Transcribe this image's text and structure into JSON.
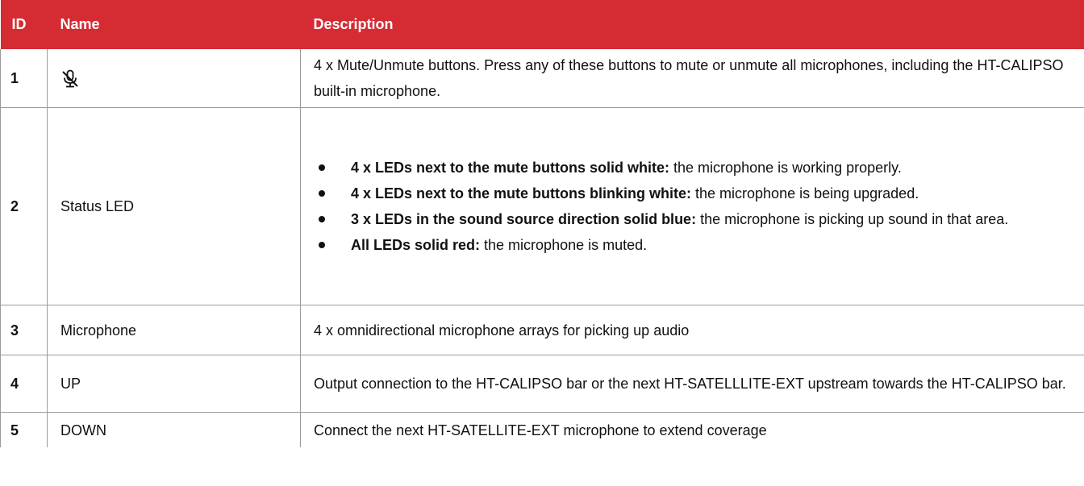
{
  "table": {
    "headers": {
      "id": "ID",
      "name": "Name",
      "description": "Description"
    },
    "rows": [
      {
        "id": "1",
        "name_icon": "mic-mute-icon",
        "description": "4 x Mute/Unmute buttons. Press any of these buttons to mute or unmute all microphones, including the HT-CALIPSO built-in microphone."
      },
      {
        "id": "2",
        "name": "Status LED",
        "bullets": [
          {
            "bold": "4 x LEDs next to the mute buttons solid white:",
            "text": " the microphone is working properly."
          },
          {
            "bold": "4 x LEDs next to the mute buttons blinking white:",
            "text": " the microphone is being upgraded."
          },
          {
            "bold": "3 x LEDs in the sound source direction solid blue:",
            "text": " the microphone is picking up sound in that area."
          },
          {
            "bold": "All LEDs solid red:",
            "text": " the microphone is muted."
          }
        ]
      },
      {
        "id": "3",
        "name": "Microphone",
        "description": "4 x omnidirectional microphone arrays for picking up audio"
      },
      {
        "id": "4",
        "name": "UP",
        "description": "Output connection to the HT-CALIPSO bar or the next HT-SATELLLITE-EXT upstream towards the HT-CALIPSO bar."
      },
      {
        "id": "5",
        "name": "DOWN",
        "description": "Connect the next HT-SATELLITE-EXT microphone to extend coverage"
      }
    ]
  },
  "colors": {
    "header_bg": "#d52b33",
    "header_text": "#ffffff",
    "border": "#9a9a9a"
  }
}
